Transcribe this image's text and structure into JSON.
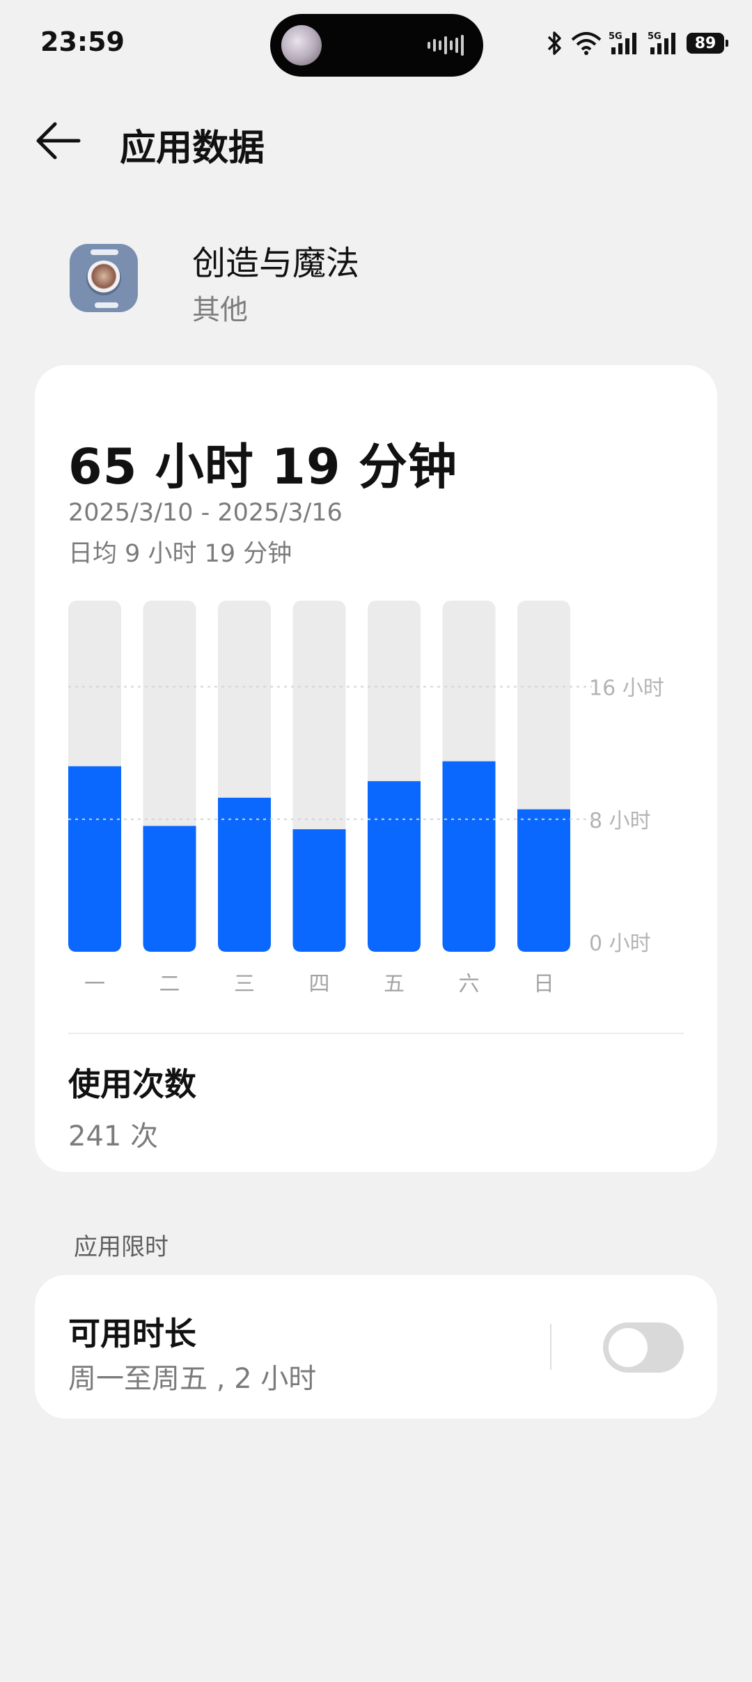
{
  "status_bar": {
    "time": "23:59",
    "battery": "89",
    "network_labels": [
      "5G",
      "5G"
    ]
  },
  "header": {
    "title": "应用数据"
  },
  "app": {
    "name": "创造与魔法",
    "category": "其他"
  },
  "usage": {
    "total": "65 小时 19 分钟",
    "date_range": "2025/3/10 - 2025/3/16",
    "daily_average": "日均 9 小时 19 分钟",
    "opens_label": "使用次数",
    "opens_value": "241 次"
  },
  "chart_data": {
    "type": "bar",
    "categories": [
      "一",
      "二",
      "三",
      "四",
      "五",
      "六",
      "日"
    ],
    "values": [
      11.2,
      7.6,
      9.3,
      7.4,
      10.3,
      11.5,
      8.6
    ],
    "ylim": [
      0,
      21.2
    ],
    "y_ticks": [
      {
        "value": 16,
        "label": "16 小时"
      },
      {
        "value": 8,
        "label": "8 小时"
      },
      {
        "value": 0,
        "label": "0 小时"
      }
    ],
    "bar_color": "#0a68ff",
    "track_color": "#ebebeb",
    "grid": true
  },
  "limits": {
    "section_title": "应用限时",
    "title": "可用时长",
    "description": "周一至周五 , 2 小时",
    "enabled": false
  },
  "colors": {
    "accent": "#0a68ff",
    "background": "#f1f1f2",
    "card": "#ffffff"
  }
}
